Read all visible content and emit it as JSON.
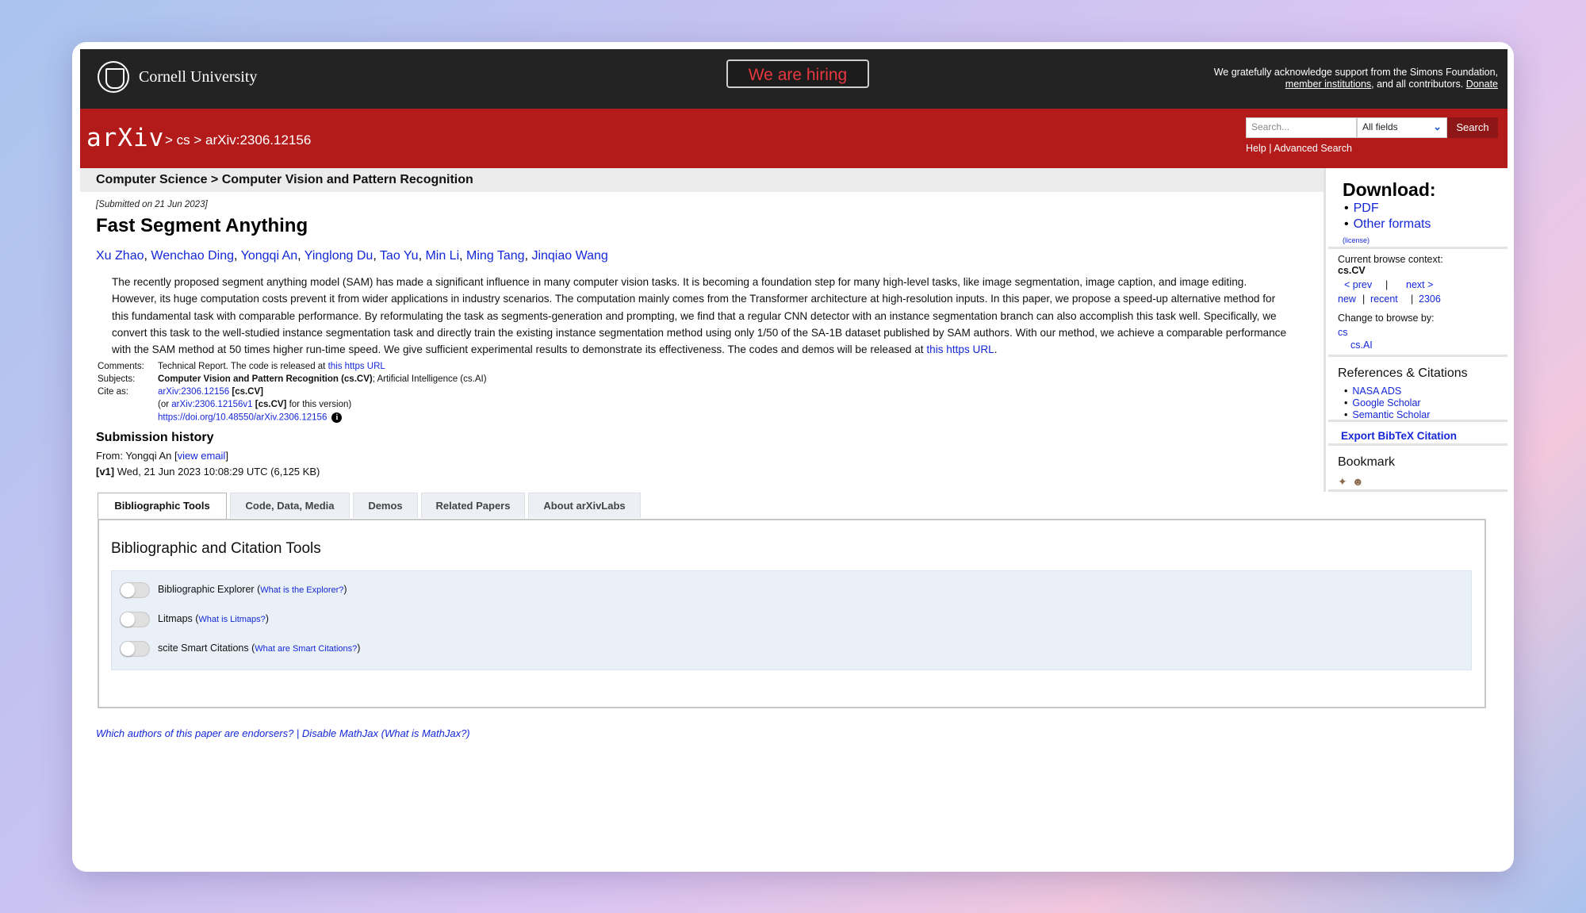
{
  "header": {
    "university": "Cornell University",
    "hiring": "We are hiring",
    "support_line1": "We gratefully acknowledge support from the Simons Foundation,",
    "support_link": "member institutions",
    "support_mid": ", and all contributors.",
    "support_donate": "Donate"
  },
  "nav": {
    "logo": "arXiv",
    "breadcrumb": "> cs > arXiv:2306.12156",
    "search_placeholder": "Search...",
    "search_field": "All fields",
    "search_button": "Search",
    "help": "Help",
    "separator": "|",
    "advanced": "Advanced Search"
  },
  "subject_header": "Computer Science > Computer Vision and Pattern Recognition",
  "paper": {
    "submitted": "[Submitted on 21 Jun 2023]",
    "title": "Fast Segment Anything",
    "authors": [
      "Xu Zhao",
      "Wenchao Ding",
      "Yongqi An",
      "Yinglong Du",
      "Tao Yu",
      "Min Li",
      "Ming Tang",
      "Jinqiao Wang"
    ],
    "abstract": "The recently proposed segment anything model (SAM) has made a significant influence in many computer vision tasks. It is becoming a foundation step for many high-level tasks, like image segmentation, image caption, and image editing. However, its huge computation costs prevent it from wider applications in industry scenarios. The computation mainly comes from the Transformer architecture at high-resolution inputs. In this paper, we propose a speed-up alternative method for this fundamental task with comparable performance. By reformulating the task as segments-generation and prompting, we find that a regular CNN detector with an instance segmentation branch can also accomplish this task well. Specifically, we convert this task to the well-studied instance segmentation task and directly train the existing instance segmentation method using only 1/50 of the SA-1B dataset published by SAM authors. With our method, we achieve a comparable performance with the SAM method at 50 times higher run-time speed. We give sufficient experimental results to demonstrate its effectiveness. The codes and demos will be released at ",
    "abstract_link": "this https URL",
    "abstract_end": "."
  },
  "meta": {
    "comments_label": "Comments:",
    "comments_text": "Technical Report. The code is released at ",
    "comments_link": "this https URL",
    "subjects_label": "Subjects:",
    "subjects_primary": "Computer Vision and Pattern Recognition (cs.CV)",
    "subjects_rest": "; Artificial Intelligence (cs.AI)",
    "cite_label": "Cite as:",
    "cite_id": "arXiv:2306.12156",
    "cite_cat": "[cs.CV]",
    "cite_v_prefix": "(or ",
    "cite_v_id": "arXiv:2306.12156v1",
    "cite_v_cat": "[cs.CV]",
    "cite_v_suffix": " for this version)",
    "doi": "https://doi.org/10.48550/arXiv.2306.12156",
    "doi_info_icon": "i"
  },
  "history": {
    "title": "Submission history",
    "from_prefix": "From: Yongqi An [",
    "from_link": "view email",
    "from_suffix": "]",
    "v1_label": "[v1]",
    "v1_text": " Wed, 21 Jun 2023 10:08:29 UTC (6,125 KB)"
  },
  "tabs": [
    "Bibliographic Tools",
    "Code, Data, Media",
    "Demos",
    "Related Papers",
    "About arXivLabs"
  ],
  "tools": {
    "title": "Bibliographic and Citation Tools",
    "items": [
      {
        "label": "Bibliographic Explorer",
        "help": "What is the Explorer?"
      },
      {
        "label": "Litmaps",
        "help": "What is Litmaps?"
      },
      {
        "label": "scite Smart Citations",
        "help": "What are Smart Citations?"
      }
    ]
  },
  "footer": {
    "endorsers": "Which authors of this paper are endorsers?",
    "sep": " | ",
    "mathjax": "Disable MathJax",
    "mathjax_help": "(What is MathJax?)"
  },
  "sidebar": {
    "download_title": "Download:",
    "download_items": [
      "PDF",
      "Other formats"
    ],
    "license": "(license)",
    "context_label": "Current browse context:",
    "context_value": "cs.CV",
    "prev": "< prev",
    "pipe": "|",
    "next": "next >",
    "new": "new",
    "recent": "recent",
    "month": "2306",
    "change_label": "Change to browse by:",
    "browse_cs": "cs",
    "browse_ai": "cs.AI",
    "refs_title": "References & Citations",
    "refs": [
      "NASA ADS",
      "Google Scholar",
      "Semantic Scholar"
    ],
    "bibtex": "Export BibTeX Citation",
    "bookmark_title": "Bookmark"
  },
  "colors": {
    "arxiv_red": "#b31b1b",
    "link_blue": "#1528d8",
    "hiring_red": "#e8383f"
  }
}
